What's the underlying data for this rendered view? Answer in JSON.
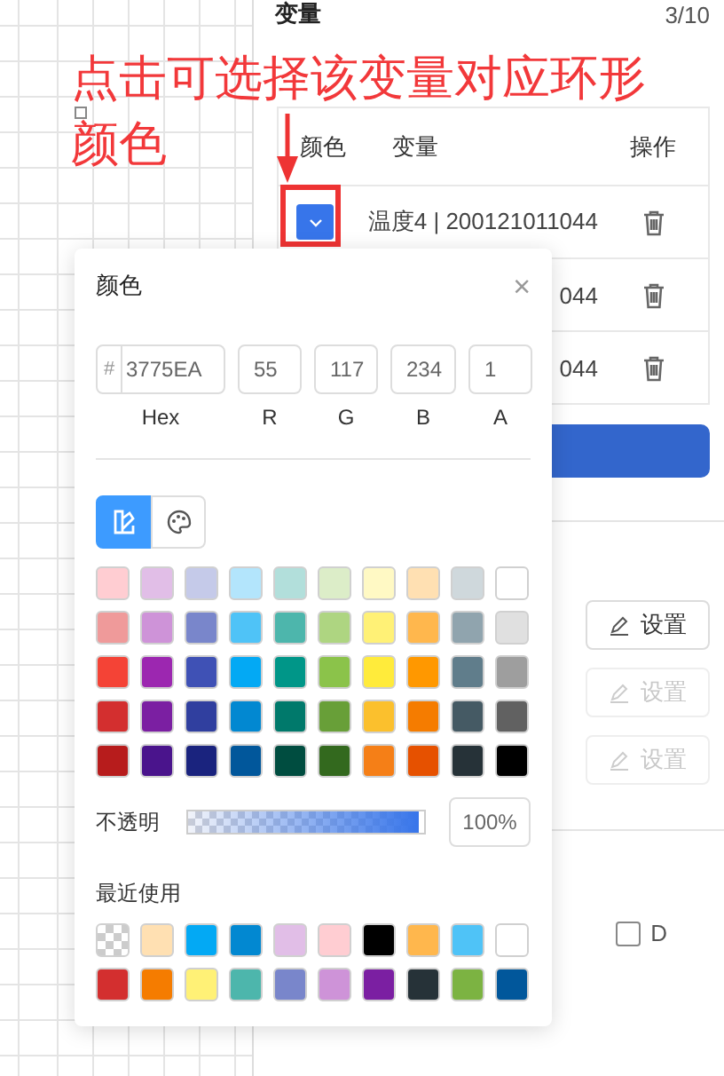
{
  "annotation": {
    "lines": [
      "点击可选择该变量对应环形",
      "颜色"
    ]
  },
  "panel": {
    "title": "变量",
    "count": "3/10"
  },
  "table": {
    "columns": [
      "颜色",
      "变量",
      "操作"
    ],
    "rows": [
      {
        "color": "#3775EA",
        "variable": "温度4 | 200121011044"
      },
      {
        "variable": "044"
      },
      {
        "variable": "044"
      }
    ]
  },
  "setting_buttons": [
    {
      "label": "设置",
      "disabled": false
    },
    {
      "label": "设置",
      "disabled": true
    },
    {
      "label": "设置",
      "disabled": true
    }
  ],
  "checkboxes": [
    {
      "label": "D",
      "checked": false
    }
  ],
  "color_picker": {
    "title": "颜色",
    "close": "×",
    "fields": [
      {
        "label": "Hex",
        "prefix": "#",
        "value": "3775EA"
      },
      {
        "label": "R",
        "value": "55"
      },
      {
        "label": "G",
        "value": "117"
      },
      {
        "label": "B",
        "value": "234"
      },
      {
        "label": "A",
        "value": "1"
      }
    ],
    "modes": [
      {
        "kind": "swatches",
        "selected": true
      },
      {
        "kind": "palette",
        "selected": false
      }
    ],
    "swatches": [
      [
        {
          "kind": "solid",
          "color": "#FFCDD2"
        },
        {
          "kind": "solid",
          "color": "#E1BEE7"
        },
        {
          "kind": "solid",
          "color": "#C5CAE9"
        },
        {
          "kind": "solid",
          "color": "#B3E5FC"
        },
        {
          "kind": "solid",
          "color": "#B2DFDB"
        },
        {
          "kind": "solid",
          "color": "#DCEDC8"
        },
        {
          "kind": "solid",
          "color": "#FFF9C4"
        },
        {
          "kind": "solid",
          "color": "#FFE0B2"
        },
        {
          "kind": "solid",
          "color": "#CFD8DC"
        },
        {
          "kind": "solid",
          "color": "#FFFFFF"
        }
      ],
      [
        {
          "kind": "solid",
          "color": "#EF9A9A"
        },
        {
          "kind": "solid",
          "color": "#CE93D8"
        },
        {
          "kind": "solid",
          "color": "#7986CB"
        },
        {
          "kind": "solid",
          "color": "#4FC3F7"
        },
        {
          "kind": "solid",
          "color": "#4DB6AC"
        },
        {
          "kind": "solid",
          "color": "#AED581"
        },
        {
          "kind": "solid",
          "color": "#FFF176"
        },
        {
          "kind": "solid",
          "color": "#FFB74D"
        },
        {
          "kind": "solid",
          "color": "#90A4AE"
        },
        {
          "kind": "solid",
          "color": "#E0E0E0"
        }
      ],
      [
        {
          "kind": "solid",
          "color": "#F44336"
        },
        {
          "kind": "solid",
          "color": "#9C27B0"
        },
        {
          "kind": "solid",
          "color": "#3F51B5"
        },
        {
          "kind": "solid",
          "color": "#03A9F4"
        },
        {
          "kind": "solid",
          "color": "#009688"
        },
        {
          "kind": "solid",
          "color": "#8BC34A"
        },
        {
          "kind": "solid",
          "color": "#FFEB3B"
        },
        {
          "kind": "solid",
          "color": "#FF9800"
        },
        {
          "kind": "solid",
          "color": "#607D8B"
        },
        {
          "kind": "solid",
          "color": "#9E9E9E"
        }
      ],
      [
        {
          "kind": "solid",
          "color": "#D32F2F"
        },
        {
          "kind": "solid",
          "color": "#7B1FA2"
        },
        {
          "kind": "solid",
          "color": "#303F9F"
        },
        {
          "kind": "solid",
          "color": "#0288D1"
        },
        {
          "kind": "solid",
          "color": "#00796B"
        },
        {
          "kind": "solid",
          "color": "#689F38"
        },
        {
          "kind": "solid",
          "color": "#FBC02D"
        },
        {
          "kind": "solid",
          "color": "#F57C00"
        },
        {
          "kind": "solid",
          "color": "#455A64"
        },
        {
          "kind": "solid",
          "color": "#616161"
        }
      ],
      [
        {
          "kind": "solid",
          "color": "#B71C1C"
        },
        {
          "kind": "solid",
          "color": "#4A148C"
        },
        {
          "kind": "solid",
          "color": "#1A237E"
        },
        {
          "kind": "solid",
          "color": "#01579B"
        },
        {
          "kind": "solid",
          "color": "#004D40"
        },
        {
          "kind": "solid",
          "color": "#33691E"
        },
        {
          "kind": "solid",
          "color": "#F57F17"
        },
        {
          "kind": "solid",
          "color": "#E65100"
        },
        {
          "kind": "solid",
          "color": "#263238"
        },
        {
          "kind": "solid",
          "color": "#000000"
        }
      ]
    ],
    "opacity": {
      "label": "不透明",
      "level": 1,
      "value": "100%"
    },
    "recent": {
      "title": "最近使用",
      "swatches": [
        {
          "kind": "transparent"
        },
        {
          "kind": "solid",
          "color": "#FFE0B2"
        },
        {
          "kind": "solid",
          "color": "#03A9F4"
        },
        {
          "kind": "solid",
          "color": "#0288D1"
        },
        {
          "kind": "solid",
          "color": "#E1BEE7"
        },
        {
          "kind": "solid",
          "color": "#FFCDD2"
        },
        {
          "kind": "solid",
          "color": "#000000"
        },
        {
          "kind": "solid",
          "color": "#FFB74D"
        },
        {
          "kind": "solid",
          "color": "#4FC3F7"
        },
        {
          "kind": "solid",
          "color": "#FFFFFF"
        },
        {
          "kind": "solid",
          "color": "#D32F2F"
        },
        {
          "kind": "solid",
          "color": "#F57C00"
        },
        {
          "kind": "solid",
          "color": "#FFF176"
        },
        {
          "kind": "solid",
          "color": "#4DB6AC"
        },
        {
          "kind": "solid",
          "color": "#7986CB"
        },
        {
          "kind": "solid",
          "color": "#CE93D8"
        },
        {
          "kind": "solid",
          "color": "#7B1FA2"
        },
        {
          "kind": "solid",
          "color": "#263238"
        },
        {
          "kind": "solid",
          "color": "#7CB342"
        },
        {
          "kind": "solid",
          "color": "#01579B"
        }
      ]
    }
  }
}
